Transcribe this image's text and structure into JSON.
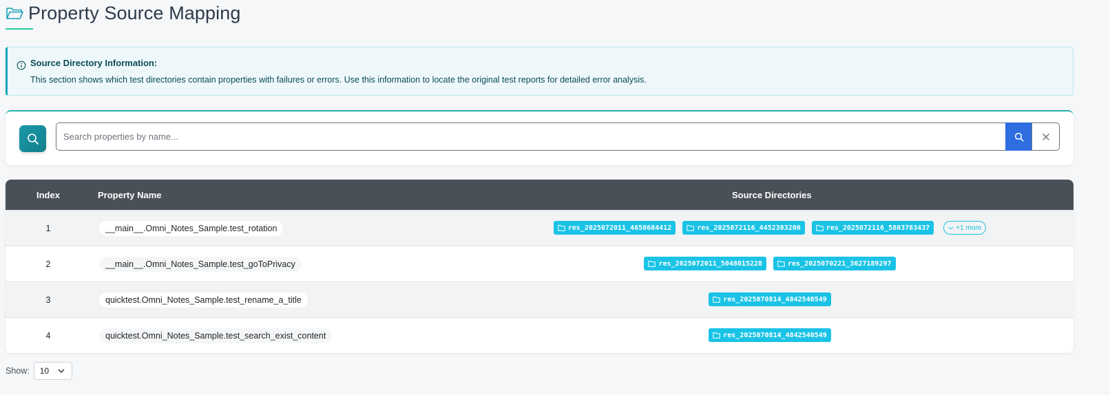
{
  "header": {
    "title": "Property Source Mapping",
    "icon": "folder-open-icon",
    "accent_color": "#20c997"
  },
  "info": {
    "title": "Source Directory Information:",
    "text": "This section shows which test directories contain properties with failures or errors. Use this information to locate the original test reports for detailed error analysis."
  },
  "search": {
    "placeholder": "Search properties by name...",
    "value": ""
  },
  "table": {
    "headers": {
      "index": "Index",
      "name": "Property Name",
      "sources": "Source Directories"
    },
    "rows": [
      {
        "index": "1",
        "name": "__main__.Omni_Notes_Sample.test_rotation",
        "dirs": [
          "res_2025072011_4658684412",
          "res_2025072116_4452303200",
          "res_2025072116_5803783437"
        ],
        "more": "+1 more"
      },
      {
        "index": "2",
        "name": "__main__.Omni_Notes_Sample.test_goToPrivacy",
        "dirs": [
          "res_2025072011_5048015228",
          "res_2025070221_3627189297"
        ],
        "more": ""
      },
      {
        "index": "3",
        "name": "quicktest.Omni_Notes_Sample.test_rename_a_title",
        "dirs": [
          "res_2025070814_4842540549"
        ],
        "more": ""
      },
      {
        "index": "4",
        "name": "quicktest.Omni_Notes_Sample.test_search_exist_content",
        "dirs": [
          "res_2025070814_4842540549"
        ],
        "more": ""
      }
    ]
  },
  "pagination": {
    "show_label": "Show:",
    "page_size": "10"
  },
  "colors": {
    "badge": "#1ac3e6",
    "header_bg": "#495057",
    "search_button": "#2f6ee0",
    "info_border": "#17a2b8"
  }
}
